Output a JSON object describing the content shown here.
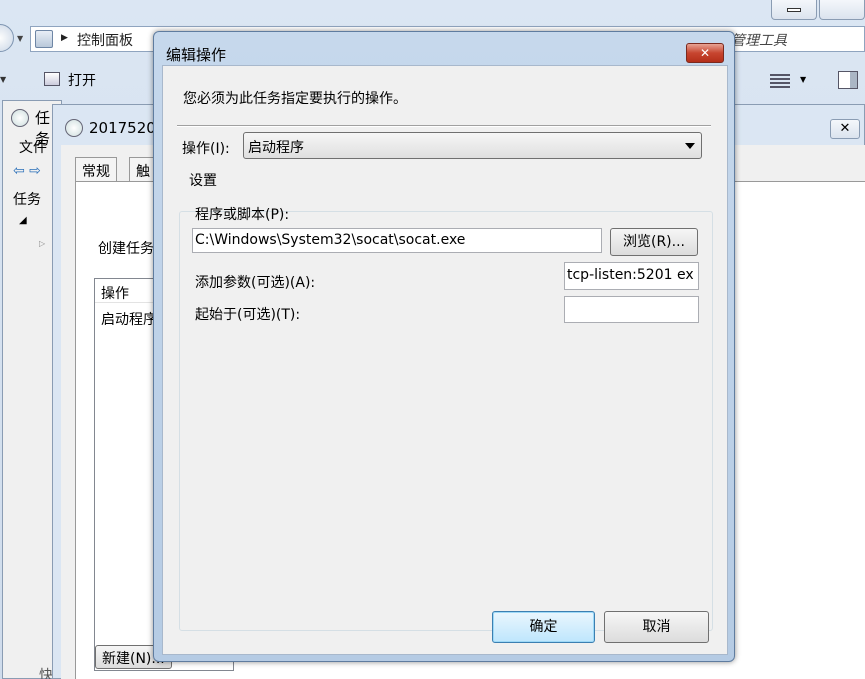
{
  "explorer": {
    "breadcrumb": "控制面板",
    "breadcrumb_right": "管理工具",
    "toolbar_open": "打开"
  },
  "task_scheduler": {
    "title": "任务",
    "menu_file": "文件",
    "tree_root": "任务",
    "bottom_text": "快"
  },
  "task_properties": {
    "title": "2017520",
    "tab_general": "常规",
    "tab_triggers": "触",
    "description": "创建任务",
    "actions_header": "操作",
    "actions_row": "启动程序",
    "new_button": "新建(N)..."
  },
  "dialog": {
    "title": "编辑操作",
    "close_glyph": "✕",
    "prompt": "您必须为此任务指定要执行的操作。",
    "action_label": "操作(I):",
    "action_value": "启动程序",
    "settings_label": "设置",
    "program_label": "程序或脚本(P):",
    "program_value": "C:\\Windows\\System32\\socat\\socat.exe",
    "browse_button": "浏览(R)...",
    "args_label": "添加参数(可选)(A):",
    "args_value": "tcp-listen:5201 ex",
    "start_label": "起始于(可选)(T):",
    "start_value": "",
    "ok_button": "确定",
    "cancel_button": "取消"
  }
}
